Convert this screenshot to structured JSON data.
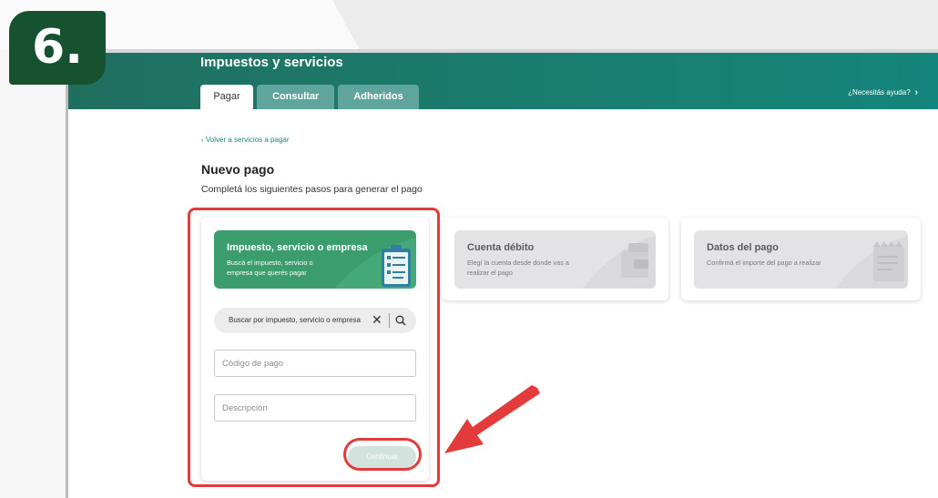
{
  "step_badge": "6.",
  "header": {
    "title": "Impuestos y servicios",
    "tabs": [
      {
        "label": "Pagar",
        "active": true
      },
      {
        "label": "Consultar",
        "active": false
      },
      {
        "label": "Adheridos",
        "active": false
      }
    ],
    "help_label": "¿Necesitás ayuda?"
  },
  "back_link": "Volver a servicios a pagar",
  "page": {
    "title": "Nuevo pago",
    "subtitle": "Completá los siguientes pasos para generar el pago"
  },
  "steps": [
    {
      "title": "Impuesto, servicio o empresa",
      "description_line1": "Buscá el impuesto, servicio o",
      "description_line2": "empresa que querés pagar",
      "active": true
    },
    {
      "title": "Cuenta débito",
      "description_line1": "Elegí la cuenta desde donde vas a",
      "description_line2": "realizar el pago",
      "active": false
    },
    {
      "title": "Datos del pago",
      "description_line1": "Confirmá el importe del pago a realizar",
      "active": false
    }
  ],
  "form": {
    "search_value": "Buscar por impuesto, servicio o empresa",
    "payment_code_placeholder": "Código de pago",
    "description_placeholder": "Descripción",
    "continue_label": "Continuar"
  },
  "colors": {
    "header_teal": "#1c7a6b",
    "active_step_green": "#3b9c6e",
    "highlight_red": "#e33b3b",
    "badge_green": "#16522f"
  }
}
